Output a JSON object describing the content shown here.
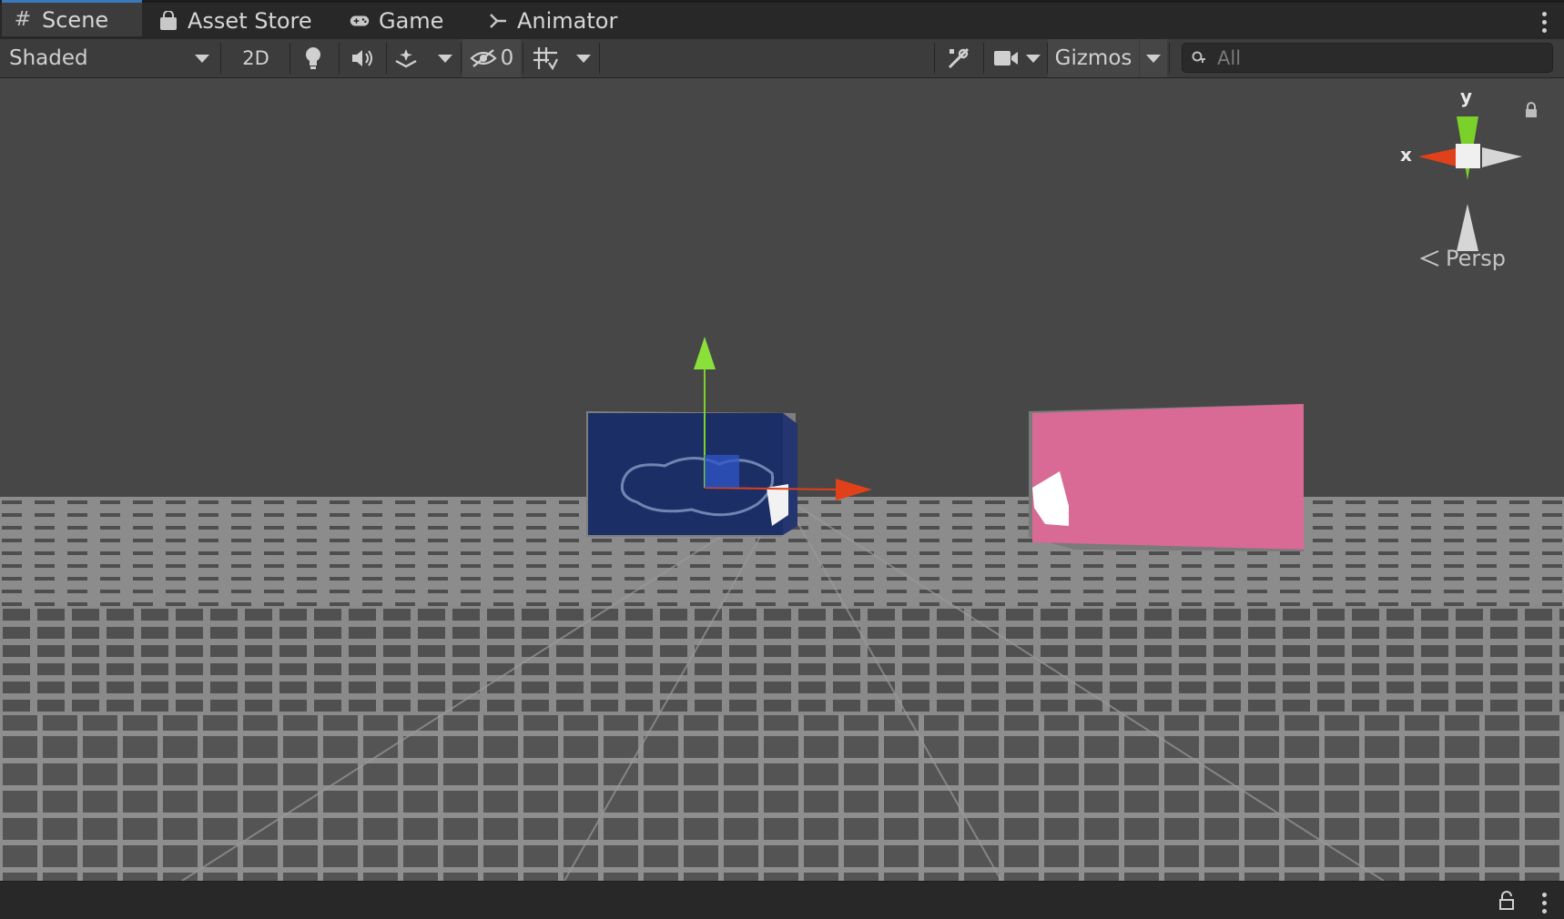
{
  "tabs": [
    {
      "label": "Scene",
      "icon": "grid-hash-icon",
      "active": true
    },
    {
      "label": "Asset Store",
      "icon": "shopping-bag-icon",
      "active": false
    },
    {
      "label": "Game",
      "icon": "gamepad-icon",
      "active": false
    },
    {
      "label": "Animator",
      "icon": "animator-branch-icon",
      "active": false
    }
  ],
  "toolbar": {
    "draw_mode": "Shaded",
    "mode_2d": "2D",
    "hidden_count": "0",
    "gizmos": "Gizmos"
  },
  "search": {
    "placeholder": "All"
  },
  "orientation": {
    "y_label": "y",
    "x_label": "x",
    "projection": "Persp"
  },
  "colors": {
    "tab_active_accent": "#3a79bb",
    "sky": "#474747",
    "ground": "#8a8a8a",
    "blue_cube": "#1c2e66",
    "pink_cube": "#d86a95",
    "axis_x": "#e0401a",
    "axis_y": "#7ad12a"
  }
}
